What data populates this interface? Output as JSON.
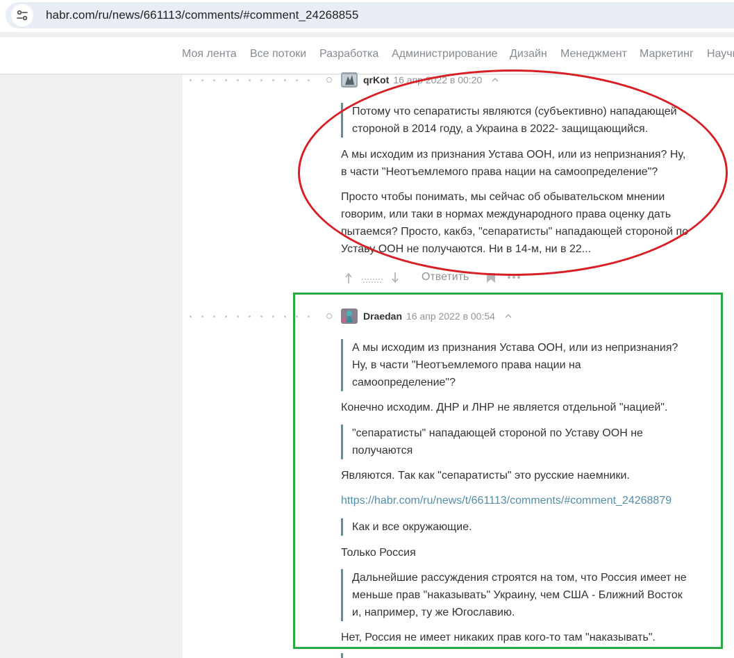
{
  "browser": {
    "url": "habr.com/ru/news/661113/comments/#comment_24268855"
  },
  "nav": {
    "items": [
      "Моя лента",
      "Все потоки",
      "Разработка",
      "Администрирование",
      "Дизайн",
      "Менеджмент",
      "Маркетинг",
      "Научп"
    ]
  },
  "comments": [
    {
      "author": "qrKot",
      "time": "16 апр 2022 в 00:20",
      "blocks": [
        {
          "type": "quote",
          "lines": [
            "Потому что сепаратисты являются (субъективно) нападающей",
            "стороной в 2014 году, а Украина в 2022- защищающийся."
          ]
        },
        {
          "type": "p",
          "lines": [
            "А мы исходим из признания Устава ООН, или из непризнания? Ну,",
            "в части \"Неотъемлемого права нации на самоопределение\"?"
          ]
        },
        {
          "type": "p",
          "lines": [
            "Просто чтобы понимать, мы сейчас об обывательском мнении",
            "говорим, или таки в нормах международного права оценку дать",
            "пытаемся? Просто, какбэ, \"сепаратисты\" нападающей стороной по",
            "Уставу ООН не получаются. Ни в 14-м, ни в 22..."
          ]
        }
      ],
      "reply_label": "Ответить"
    },
    {
      "author": "Draedan",
      "time": "16 апр 2022 в 00:54",
      "blocks": [
        {
          "type": "quote",
          "lines": [
            "А мы исходим из признания Устава ООН, или из непризнания?",
            "Ну, в части \"Неотъемлемого права нации на",
            "самоопределение\"?"
          ]
        },
        {
          "type": "p",
          "lines": [
            "Конечно исходим. ДНР и ЛНР не является отдельной \"нацией\"."
          ]
        },
        {
          "type": "quote",
          "lines": [
            "\"сепаратисты\" нападающей стороной по Уставу ООН не",
            "получаются"
          ]
        },
        {
          "type": "p",
          "lines": [
            "Являются. Так как \"сепаратисты\" это русские наемники."
          ]
        },
        {
          "type": "link",
          "lines": [
            "https://habr.com/ru/news/t/661113/comments/#comment_24268879"
          ]
        },
        {
          "type": "quote",
          "lines": [
            "Как и все окружающие."
          ]
        },
        {
          "type": "p",
          "lines": [
            "Только Россия"
          ]
        },
        {
          "type": "quote",
          "lines": [
            "Дальнейшие рассуждения строятся на том, что Россия имеет не",
            "меньше прав \"наказывать\" Украину, чем США - Ближний Восток",
            "и, например, ту же Югославию."
          ]
        },
        {
          "type": "p",
          "lines": [
            "Нет, Россия не имеет никаких прав кого-то там \"наказывать\"."
          ]
        }
      ]
    }
  ],
  "colors": {
    "annotation_red": "#d81f26",
    "annotation_green": "#27a844",
    "quote_bar": "#5e8d9c",
    "link": "#548eaa"
  }
}
